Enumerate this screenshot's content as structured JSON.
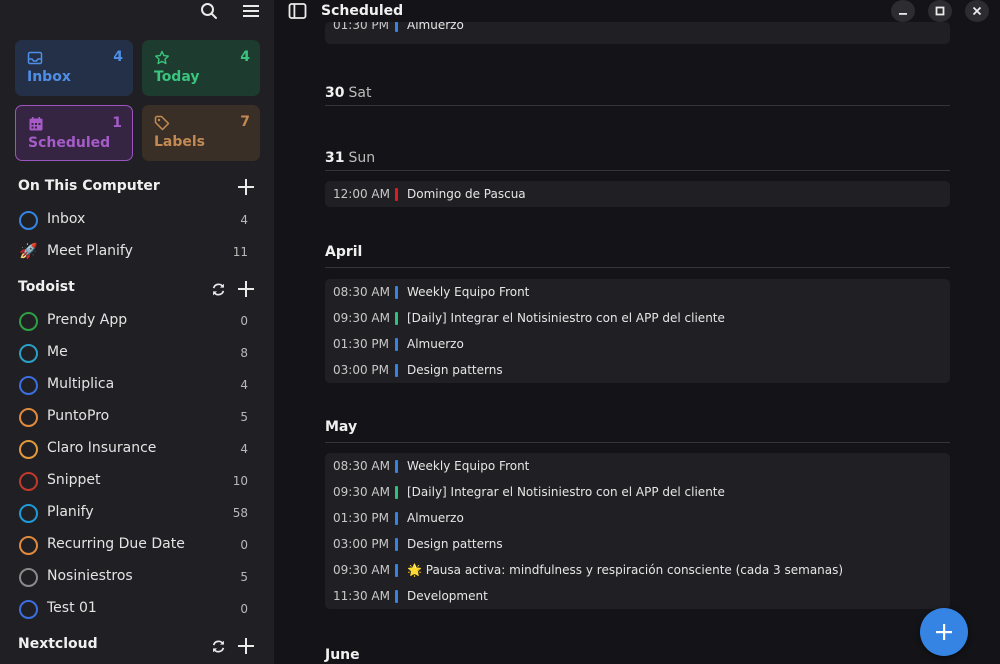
{
  "sidebar": {
    "cards": {
      "inbox": {
        "label": "Inbox",
        "count": "4"
      },
      "today": {
        "label": "Today",
        "count": "4"
      },
      "scheduled": {
        "label": "Scheduled",
        "count": "1"
      },
      "labels": {
        "label": "Labels",
        "count": "7"
      }
    },
    "sections": {
      "local": {
        "title": "On This Computer",
        "items": [
          {
            "name": "Inbox",
            "count": "4",
            "color": "#3584e4"
          },
          {
            "name": "Meet Planify",
            "count": "11",
            "emoji": "🚀"
          }
        ]
      },
      "todoist": {
        "title": "Todoist",
        "items": [
          {
            "name": "Prendy App",
            "count": "0",
            "color": "#2ea043"
          },
          {
            "name": "Me",
            "count": "8",
            "color": "#2b9fc4"
          },
          {
            "name": "Multiplica",
            "count": "4",
            "color": "#3d6ee0"
          },
          {
            "name": "PuntoPro",
            "count": "5",
            "color": "#e08a3c"
          },
          {
            "name": "Claro Insurance",
            "count": "4",
            "color": "#e09a3c"
          },
          {
            "name": "Snippet",
            "count": "10",
            "color": "#c0392b"
          },
          {
            "name": "Planify",
            "count": "58",
            "color": "#1e9ad6"
          },
          {
            "name": "Recurring Due Date",
            "count": "0",
            "color": "#e08a3c"
          },
          {
            "name": "Nosiniestros",
            "count": "5",
            "color": "#8a8a8a"
          },
          {
            "name": "Test 01",
            "count": "0",
            "color": "#3d6ee0"
          }
        ]
      },
      "nextcloud": {
        "title": "Nextcloud"
      }
    }
  },
  "header": {
    "title": "Scheduled"
  },
  "agenda": {
    "partial_top": {
      "time": "01:30 PM",
      "title": "Almuerzo"
    },
    "day30": {
      "num": "30",
      "name": "Sat"
    },
    "day31": {
      "num": "31",
      "name": "Sun"
    },
    "day31_events": [
      {
        "time": "12:00 AM",
        "title": "Domingo de Pascua",
        "color": "#e01b24"
      }
    ],
    "april": {
      "title": "April",
      "events": [
        {
          "time": "08:30 AM",
          "title": "Weekly Equipo Front",
          "color": "#3584e4"
        },
        {
          "time": "09:30 AM",
          "title": "[Daily] Integrar el Notisiniestro con el APP del cliente",
          "color": "#2ec27e"
        },
        {
          "time": "01:30 PM",
          "title": "Almuerzo",
          "color": "#3584e4"
        },
        {
          "time": "03:00 PM",
          "title": "Design patterns",
          "color": "#3584e4"
        }
      ]
    },
    "may": {
      "title": "May",
      "events": [
        {
          "time": "08:30 AM",
          "title": "Weekly Equipo Front",
          "color": "#3584e4"
        },
        {
          "time": "09:30 AM",
          "title": "[Daily] Integrar el Notisiniestro con el APP del cliente",
          "color": "#2ec27e"
        },
        {
          "time": "01:30 PM",
          "title": "Almuerzo",
          "color": "#3584e4"
        },
        {
          "time": "03:00 PM",
          "title": "Design patterns",
          "color": "#3584e4"
        },
        {
          "time": "09:30 AM",
          "title": "🌟 Pausa activa: mindfulness y respiración consciente (cada 3 semanas)",
          "color": "#3584e4"
        },
        {
          "time": "11:30 AM",
          "title": "Development",
          "color": "#3584e4"
        }
      ]
    },
    "june": {
      "title": "June"
    }
  }
}
